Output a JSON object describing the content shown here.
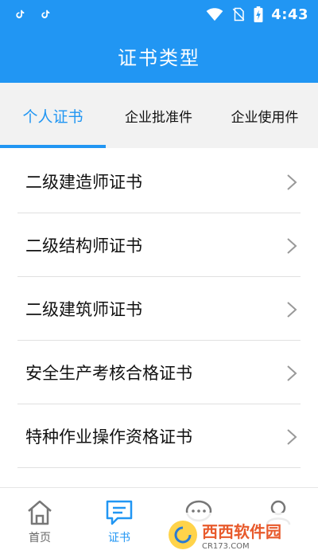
{
  "colors": {
    "primary": "#2196f3",
    "text": "#111111",
    "muted": "#666666"
  },
  "status_bar": {
    "time": "4:43",
    "icons": [
      "tiktok-icon",
      "tiktok-icon",
      "wifi-icon",
      "sim-off-icon",
      "battery-charging-icon"
    ]
  },
  "header": {
    "title": "证书类型"
  },
  "tabs": [
    {
      "label": "个人证书",
      "active": true
    },
    {
      "label": "企业批准件",
      "active": false
    },
    {
      "label": "企业使用件",
      "active": false
    }
  ],
  "list": {
    "items": [
      {
        "label": "二级建造师证书"
      },
      {
        "label": "二级结构师证书"
      },
      {
        "label": "二级建筑师证书"
      },
      {
        "label": "安全生产考核合格证书"
      },
      {
        "label": "特种作业操作资格证书"
      }
    ]
  },
  "bottom_nav": {
    "items": [
      {
        "label": "首页",
        "icon": "home-icon",
        "active": false
      },
      {
        "label": "证书",
        "icon": "certificate-icon",
        "active": true
      },
      {
        "label": "",
        "icon": "message-icon",
        "active": false
      },
      {
        "label": "",
        "icon": "user-icon",
        "active": false
      }
    ]
  },
  "watermark": {
    "brand": "西西软件园",
    "url": "CR173.COM"
  }
}
